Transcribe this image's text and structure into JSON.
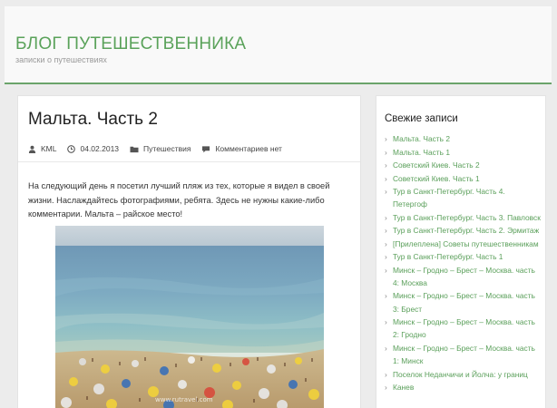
{
  "site": {
    "title": "БЛОГ ПУТЕШЕСТВЕННИКА",
    "description": "записки о путешествиях",
    "accent_color": "#5aa25a"
  },
  "post": {
    "title": "Мальта. Часть 2",
    "meta": {
      "author": "KML",
      "date": "04.02.2013",
      "category": "Путешествия",
      "comments": "Комментариев нет"
    },
    "paragraph": "На следующий день я посетил лучший пляж из тех, которые я видел в своей жизни. Наслаждайтесь фотографиями, ребята. Здесь не нужны какие-либо комментарии. Мальта – райское место!",
    "image_watermark": "www.rutravel.com",
    "image_alt": "beach-photo"
  },
  "sidebar": {
    "widget_title": "Свежие записи",
    "items": [
      "Мальта. Часть 2",
      "Мальта. Часть 1",
      "Советский Киев. Часть 2",
      "Советский Киев. Часть 1",
      "Тур в Санкт-Петербург. Часть 4. Петергоф",
      "Тур в Санкт-Петербург. Часть 3. Павловск",
      "Тур в Санкт-Петербург. Часть 2. Эрмитаж",
      "[Прилеплена] Советы путешественникам",
      "Тур в Санкт-Петербург. Часть 1",
      "Минск – Гродно – Брест – Москва. часть 4: Москва",
      "Минск – Гродно – Брест – Москва. часть 3: Брест",
      "Минск – Гродно – Брест – Москва. часть 2: Гродно",
      "Минск – Гродно – Брест – Москва. часть 1: Минск",
      "Поселок Неданчичи и Йолча: у границ",
      "Канев"
    ]
  },
  "icons": {
    "author": "user-icon",
    "date": "clock-icon",
    "category": "folder-icon",
    "comments": "comment-icon"
  }
}
